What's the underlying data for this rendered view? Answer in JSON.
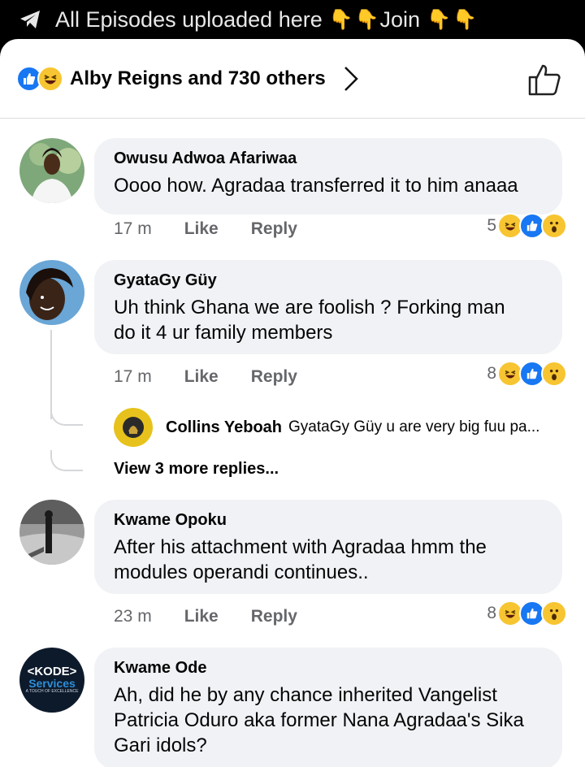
{
  "topbar": {
    "text": "All Episodes uploaded here",
    "join": "Join",
    "pointing_emoji": "👇"
  },
  "reactions_header": {
    "summary": "Alby Reigns and 730 others",
    "icons": [
      "like-icon",
      "haha-icon"
    ]
  },
  "comments": [
    {
      "name": "Owusu Adwoa Afariwaa",
      "text": "Oooo how. Agradaa transferred it to him anaaa",
      "time": "17 m",
      "like": "Like",
      "reply": "Reply",
      "reaction_count": "5"
    },
    {
      "name": "GyataGy Güy",
      "text_line1": "Uh think Ghana we are foolish ? Forking man",
      "text_line2": "do it 4 ur family members",
      "time": "17 m",
      "like": "Like",
      "reply": "Reply",
      "reaction_count": "8"
    },
    {
      "name": "Kwame Opoku",
      "text_line1": "After his attachment with Agradaa hmm the",
      "text_line2": "modules operandi continues..",
      "time": "23 m",
      "like": "Like",
      "reply": "Reply",
      "reaction_count": "8"
    },
    {
      "name": "Kwame Ode",
      "text_line1": "Ah, did he by any chance inherited Vangelist",
      "text_line2": "Patricia Oduro aka former Nana Agradaa's Sika",
      "text_line3": "Gari idols?",
      "avatar_logo_line1": "<KODE>",
      "avatar_logo_line2": "Services",
      "avatar_logo_line3": "A TOUCH OF EXCELLENCE"
    }
  ],
  "reply": {
    "name": "Collins Yeboah",
    "text": "GyataGy Güy u are very big fuu pa..."
  },
  "view_more": "View 3 more replies...",
  "colors": {
    "facebook_blue": "#1877f2",
    "bubble_bg": "#f0f2f5",
    "meta_grey": "#65676b",
    "reaction_yellow": "#f7c531"
  }
}
